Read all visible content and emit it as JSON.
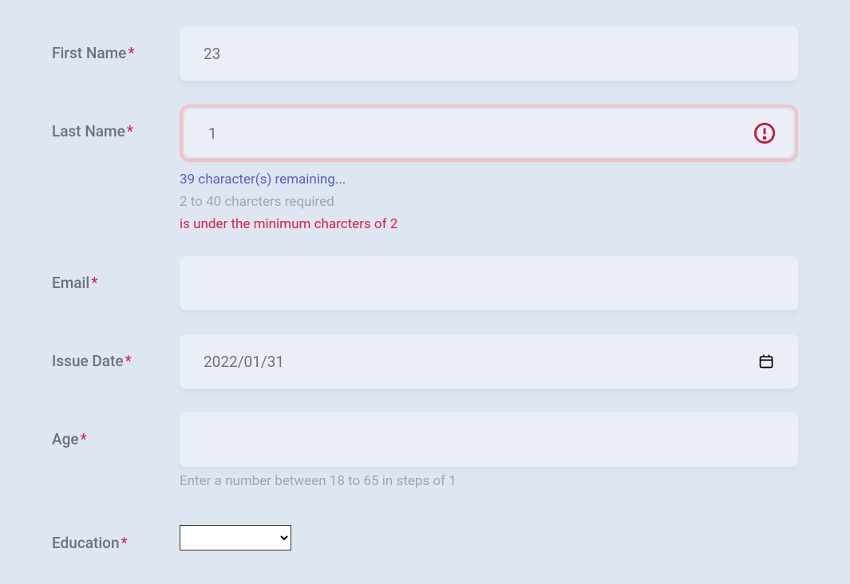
{
  "fields": {
    "firstName": {
      "label": "First Name",
      "value": "23",
      "required": true
    },
    "lastName": {
      "label": "Last Name",
      "value": "1",
      "required": true,
      "hints": {
        "remaining": "39 character(s) remaining...",
        "requirement": "2 to 40 charcters required",
        "error": "is under the minimum charcters of 2"
      }
    },
    "email": {
      "label": "Email",
      "value": "",
      "required": true
    },
    "issueDate": {
      "label": "Issue Date",
      "value": "2022/01/31",
      "required": true
    },
    "age": {
      "label": "Age",
      "value": "",
      "required": true,
      "hint": "Enter a number between 18 to 65 in steps of 1"
    },
    "education": {
      "label": "Education",
      "value": "",
      "required": true
    }
  }
}
